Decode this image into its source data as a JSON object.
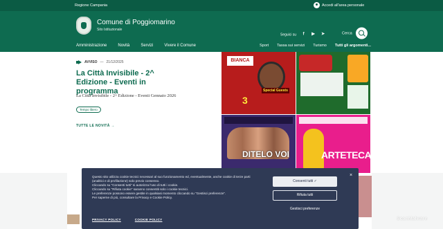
{
  "topbar": {
    "region": "Regione Campania",
    "login_label": "Accedi all'area personale"
  },
  "header": {
    "title": "Comune di Poggiomarino",
    "subtitle": "Sito Istituzionale",
    "social_label": "Seguici su",
    "search_label": "Cerca"
  },
  "nav": {
    "main_items": [
      "Amministrazione",
      "Novità",
      "Servizi",
      "Vivere il Comune"
    ],
    "secondary_items": [
      "Sport",
      "Tassa sui servizi",
      "Turismo",
      "Tutti gli argomenti..."
    ]
  },
  "news": {
    "category": "AVVISO",
    "date": "21/12/2025",
    "title": "La Città Invisibile - 2^ Edizione - Eventi in programma",
    "description": "La Città Invisibile - 2^ Edizione - Eventi Gennaio 2026",
    "chip": "Tempo libero",
    "all_link": "TUTTE LE NOVITÀ"
  },
  "posters": {
    "p1_banner": "BIANCA",
    "p1_date": "3",
    "p1_guests": "Special Guests",
    "p3_title": "DITELO VOI",
    "p4_title": "ARTETECA"
  },
  "cookie": {
    "lines": [
      "Questo sito utilizza cookie tecnici necessari al suo funzionamento ed, eventualmente, anche cookie di terze parti (analitici e di profilazione) solo previo consenso.",
      "Cliccando su \"Consenti tutti\" si autorizza l'uso di tutti i cookie.",
      "Cliccando su \"Rifiuta cookie\" saranno consentiti solo i cookie tecnici.",
      "Le preferenze possono essere gestite in qualsiasi momento cliccando su \"Gestisci preferenze\".",
      "Per saperne di più, consultare la Privacy e Cookie Policy."
    ],
    "privacy_link": "PRIVACY POLICY",
    "cookie_link": "COOKIE POLICY",
    "accept_label": "Consenti tutti",
    "reject_label": "Rifiuta tutti",
    "manage_label": "Gestisci preferenze",
    "close_label": "×"
  },
  "watermark": "ScanMalware",
  "icons": {
    "social": [
      "facebook-icon",
      "youtube-icon",
      "telegram-icon"
    ],
    "search": "search-icon",
    "user": "user-icon"
  },
  "colors": {
    "primary": "#0e6b50",
    "dark_primary": "#0b5b44",
    "cookie_bg": "#2f3a55"
  }
}
